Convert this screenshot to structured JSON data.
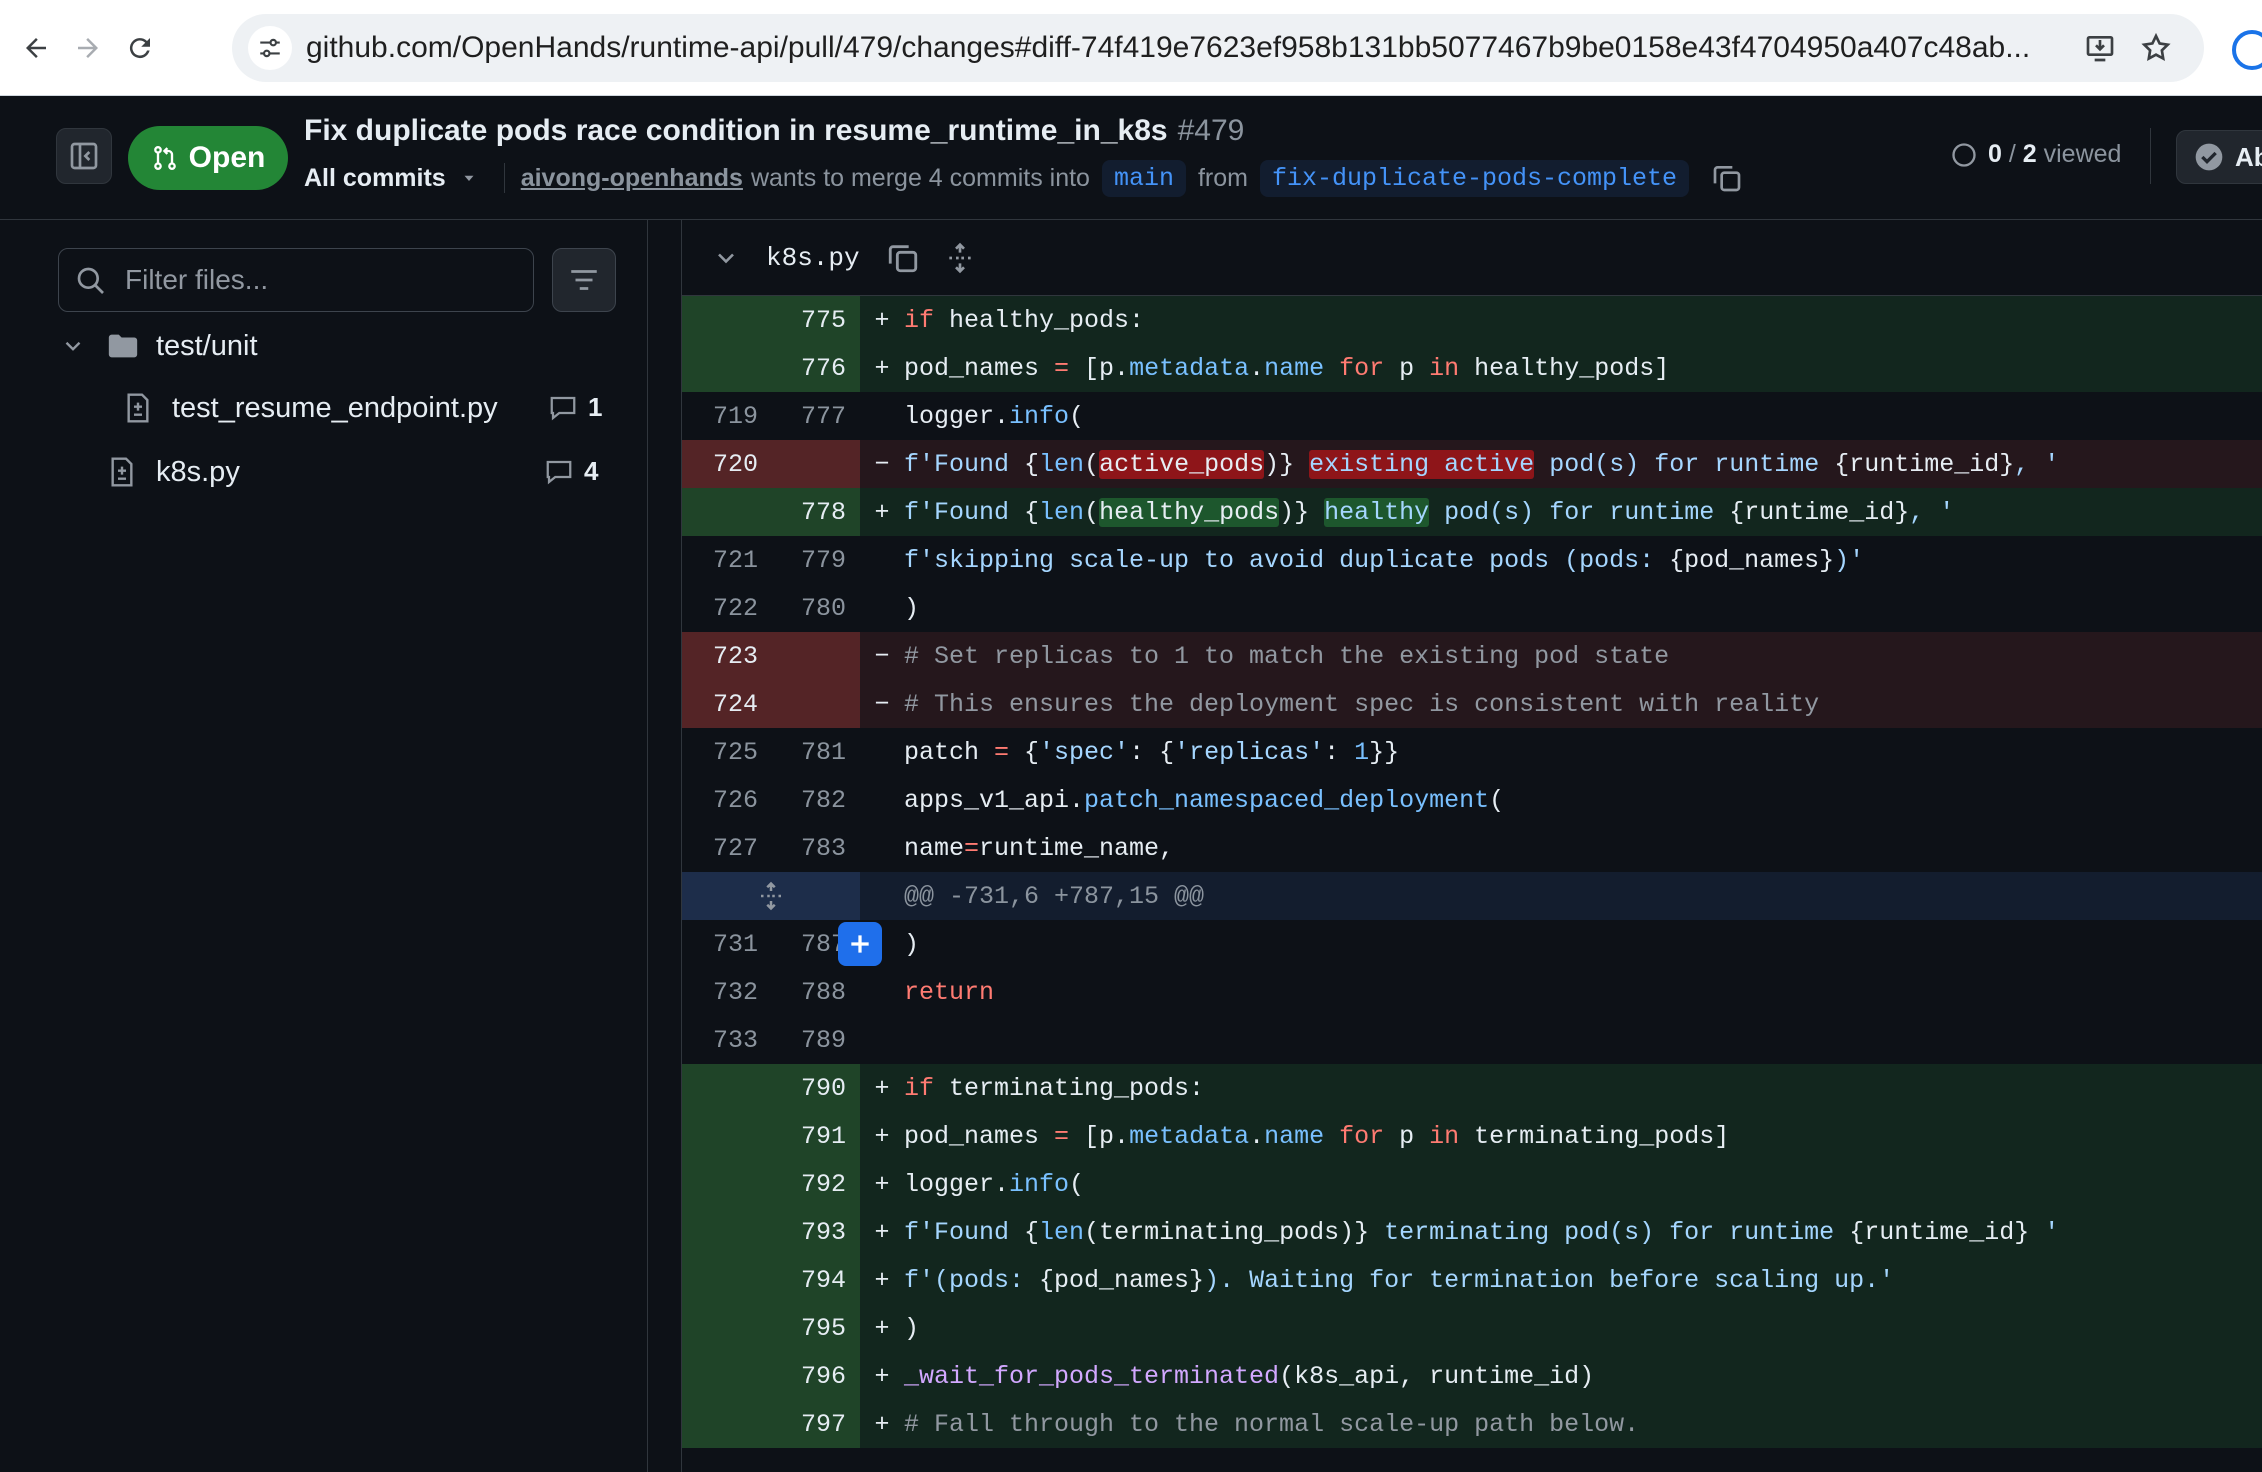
{
  "browser": {
    "url": "github.com/OpenHands/runtime-api/pull/479/changes#diff-74f419e7623ef958b131bb5077467b9be0158e43f4704950a407c48ab..."
  },
  "pr": {
    "state": "Open",
    "title": "Fix duplicate pods race condition in resume_runtime_in_k8s",
    "number": "#479",
    "commits_dropdown": "All commits",
    "author": "aivong-openhands",
    "merge_text": "wants to merge 4 commits into",
    "base_branch": "main",
    "from_text": "from",
    "head_branch": "fix-duplicate-pods-complete",
    "viewed_count": "0",
    "viewed_sep": "/",
    "viewed_total": "2",
    "viewed_label": "viewed",
    "approve_label": "Ab"
  },
  "sidebar": {
    "filter_placeholder": "Filter files...",
    "folder": "test/unit",
    "files": [
      {
        "name": "test_resume_endpoint.py",
        "comments": "1"
      },
      {
        "name": "k8s.py",
        "comments": "4"
      }
    ]
  },
  "diff": {
    "file_name": "k8s.py",
    "hunk_header": "@@ -731,6 +787,15 @@",
    "lines": [
      {
        "old": "",
        "new": "775",
        "m": "+"
      },
      {
        "old": "",
        "new": "776",
        "m": "+"
      },
      {
        "old": "719",
        "new": "777",
        "m": ""
      },
      {
        "old": "720",
        "new": "",
        "m": "−"
      },
      {
        "old": "",
        "new": "778",
        "m": "+"
      },
      {
        "old": "721",
        "new": "779",
        "m": ""
      },
      {
        "old": "722",
        "new": "780",
        "m": ""
      },
      {
        "old": "723",
        "new": "",
        "m": "−"
      },
      {
        "old": "724",
        "new": "",
        "m": "−"
      },
      {
        "old": "725",
        "new": "781",
        "m": ""
      },
      {
        "old": "726",
        "new": "782",
        "m": ""
      },
      {
        "old": "727",
        "new": "783",
        "m": ""
      },
      {
        "old": "731",
        "new": "787",
        "m": ""
      },
      {
        "old": "732",
        "new": "788",
        "m": ""
      },
      {
        "old": "733",
        "new": "789",
        "m": ""
      },
      {
        "old": "",
        "new": "790",
        "m": "+"
      },
      {
        "old": "",
        "new": "791",
        "m": "+"
      },
      {
        "old": "",
        "new": "792",
        "m": "+"
      },
      {
        "old": "",
        "new": "793",
        "m": "+"
      },
      {
        "old": "",
        "new": "794",
        "m": "+"
      },
      {
        "old": "",
        "new": "795",
        "m": "+"
      },
      {
        "old": "",
        "new": "796",
        "m": "+"
      },
      {
        "old": "",
        "new": "797",
        "m": "+"
      }
    ],
    "code": {
      "l775_kw": "if",
      "l775_rest": " healthy_pods:",
      "l776_a": "pod_names ",
      "l776_eq": "=",
      "l776_b": " [p.",
      "l776_attr1": "metadata",
      "l776_dot": ".",
      "l776_attr2": "name",
      "l776_for": " for",
      "l776_p": " p ",
      "l776_in": "in",
      "l776_c": " healthy_pods]",
      "l777_a": "logger.",
      "l777_fn": "info",
      "l777_b": "(",
      "l720_a": "f'Found ",
      "l720_b": "{",
      "l720_len": "len",
      "l720_c": "(",
      "l720_hl1": "active_pods",
      "l720_d": ")}",
      "l720_sp": " ",
      "l720_hl2": "existing active",
      "l720_e": " pod(s) for runtime ",
      "l720_f": "{runtime_id}",
      "l720_g": ", '",
      "l778_a": "f'Found ",
      "l778_b": "{",
      "l778_len": "len",
      "l778_c": "(",
      "l778_hl1": "healthy_pods",
      "l778_d": ")}",
      "l778_sp": " ",
      "l778_hl2": "healthy",
      "l778_e": " pod(s) for runtime ",
      "l778_f": "{runtime_id}",
      "l778_g": ", '",
      "l779_a": "f'skipping scale-up to avoid duplicate pods (pods: ",
      "l779_b": "{pod_names}",
      "l779_c": ")'",
      "l780": ")",
      "l723": "# Set replicas to 1 to match the existing pod state",
      "l724": "# This ensures the deployment spec is consistent with reality",
      "l781_a": "patch ",
      "l781_eq": "=",
      "l781_b": " {",
      "l781_s1": "'spec'",
      "l781_c": ": {",
      "l781_s2": "'replicas'",
      "l781_d": ": ",
      "l781_n": "1",
      "l781_e": "}}",
      "l782_a": "apps_v1_api.",
      "l782_fn": "patch_namespaced_deployment",
      "l782_b": "(",
      "l783_a": "name",
      "l783_eq": "=",
      "l783_b": "runtime_name,",
      "l787": ")",
      "l788": "return",
      "l790_kw": "if",
      "l790_rest": " terminating_pods:",
      "l791_a": "pod_names ",
      "l791_eq": "=",
      "l791_b": " [p.",
      "l791_attr1": "metadata",
      "l791_dot": ".",
      "l791_attr2": "name",
      "l791_for": " for",
      "l791_p": " p ",
      "l791_in": "in",
      "l791_c": " terminating_pods]",
      "l792_a": "logger.",
      "l792_fn": "info",
      "l792_b": "(",
      "l793_a": "f'Found ",
      "l793_b": "{",
      "l793_len": "len",
      "l793_c": "(terminating_pods)}",
      "l793_d": " terminating pod(s) for runtime ",
      "l793_e": "{runtime_id}",
      "l793_f": " '",
      "l794_a": "f'(pods: ",
      "l794_b": "{pod_names}",
      "l794_c": "). Waiting for termination before scaling up.'",
      "l795": ")",
      "l796_fn": "_wait_for_pods_terminated",
      "l796_b": "(k8s_api, runtime_id)",
      "l797": "# Fall through to the normal scale-up path below."
    }
  }
}
